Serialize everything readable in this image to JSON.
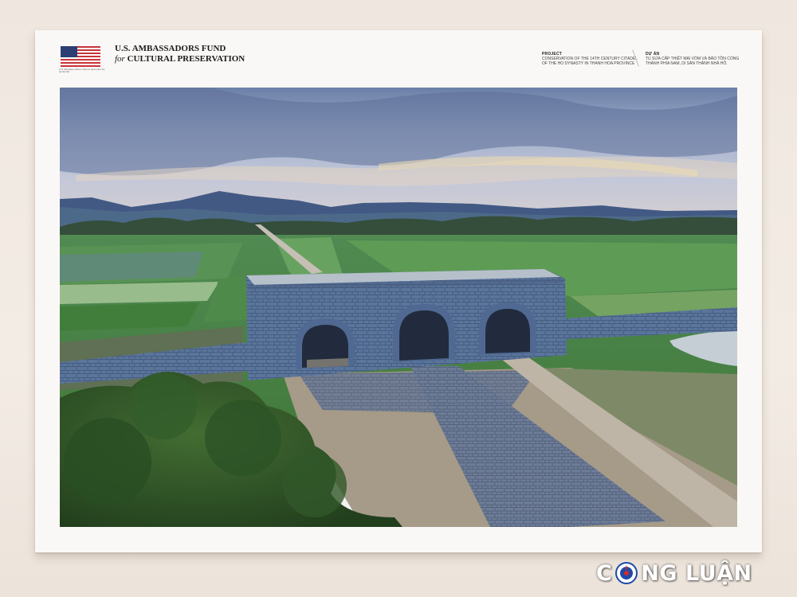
{
  "header": {
    "flag_icon": "us-flag-icon",
    "flag_caption": "U.S. Embassy Hanoi / Đại sứ quán Hoa Kỳ tại Hà Nội",
    "fund_line1": "U.S. AMBASSADORS FUND",
    "fund_line2_prefix": "for",
    "fund_line2": "CULTURAL PRESERVATION",
    "project_label_en": "PROJECT",
    "project_text_en": "CONSERVATION OF THE 14TH CENTURY CITADEL OF THE HO DYNASTY IN THANH HOA PROVINCE",
    "project_label_vi": "DỰ ÁN",
    "project_text_vi": "TU SỬA CẤP THIẾT MÁI VÒM VÀ BẢO TỒN CỔNG THÀNH PHÍA NAM, DI SẢN THÀNH NHÀ HỒ."
  },
  "photo": {
    "subject": "South gate of the Ho Dynasty Citadel with green rice fields and mountains"
  },
  "watermark": {
    "left_text": "C",
    "right_text": "NG LUẬN",
    "emblem_icon": "cong-luan-emblem-icon"
  }
}
